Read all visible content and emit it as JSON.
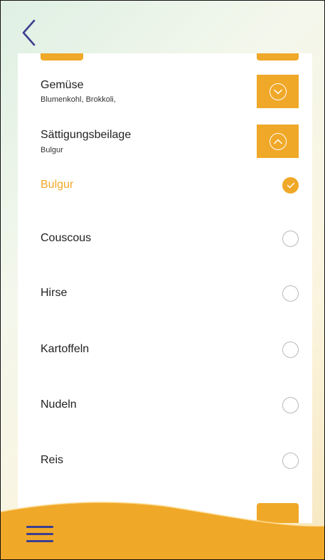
{
  "colors": {
    "accent": "#f0a828",
    "nav_blue": "#3a3f8f",
    "radio_border": "#b9b9b9"
  },
  "header": {
    "back_icon": "chevron-left-icon"
  },
  "sections": [
    {
      "title": "Gemüse",
      "subtitle": "Blumenkohl, Brokkoli,",
      "state": "collapsed",
      "toggle_icon": "chevron-down-circle-icon"
    },
    {
      "title": "Sättigungsbeilage",
      "subtitle": "Bulgur",
      "state": "expanded",
      "toggle_icon": "chevron-up-circle-icon"
    }
  ],
  "options": [
    {
      "label": "Bulgur",
      "selected": true
    },
    {
      "label": "Couscous",
      "selected": false
    },
    {
      "label": "Hirse",
      "selected": false
    },
    {
      "label": "Kartoffeln",
      "selected": false
    },
    {
      "label": "Nudeln",
      "selected": false
    },
    {
      "label": "Reis",
      "selected": false
    }
  ],
  "footer": {
    "menu_icon": "hamburger-menu-icon"
  }
}
